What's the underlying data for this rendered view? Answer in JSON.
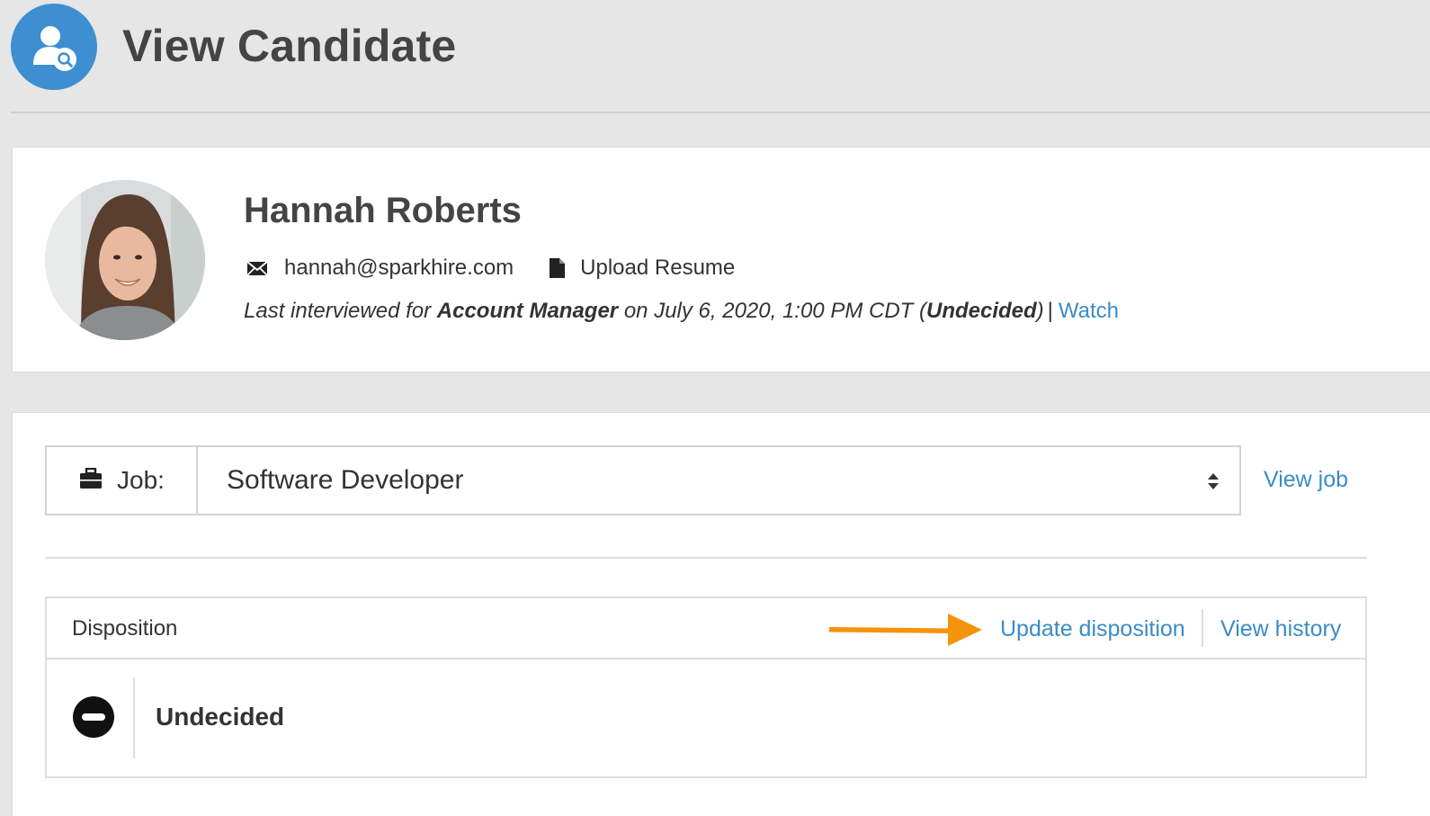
{
  "header": {
    "title": "View Candidate",
    "icon": "user-search-icon",
    "icon_bg": "#3d8fd1"
  },
  "candidate": {
    "name": "Hannah Roberts",
    "email": "hannah@sparkhire.com",
    "upload_resume_label": "Upload Resume",
    "interview": {
      "prefix": "Last interviewed for ",
      "position": "Account Manager",
      "date_text": " on July 6, 2020, 1:00 PM CDT (",
      "status": "Undecided",
      "suffix": ")",
      "separator": "|",
      "watch_label": "Watch"
    }
  },
  "job": {
    "label": "Job:",
    "selected": "Software Developer",
    "view_job_label": "View job"
  },
  "disposition": {
    "title": "Disposition",
    "update_label": "Update disposition",
    "history_label": "View history",
    "status": "Undecided",
    "status_icon": "minus-circle-icon"
  },
  "colors": {
    "link": "#3b8bc7",
    "annotation_arrow": "#f5930c",
    "page_bg": "#e6e6e6"
  }
}
